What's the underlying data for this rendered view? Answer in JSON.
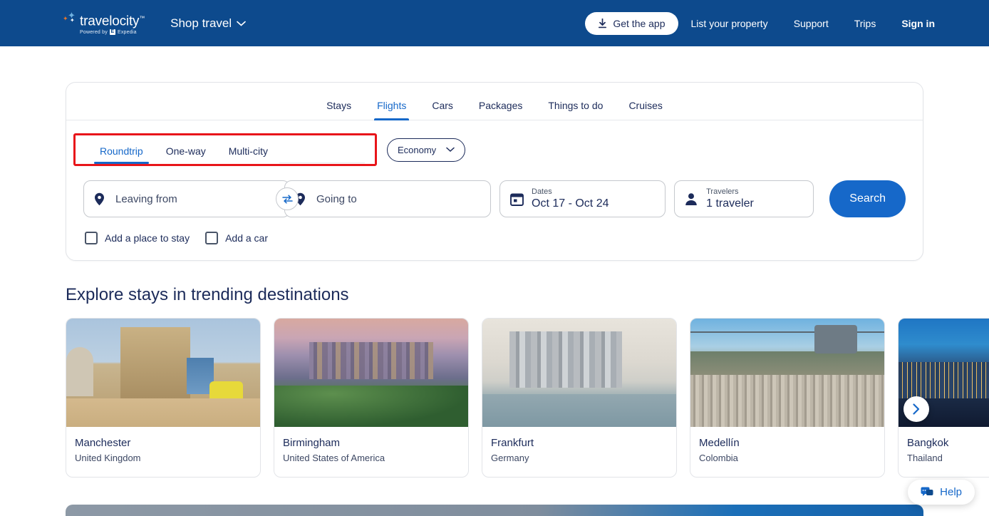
{
  "header": {
    "brand": {
      "name": "travelocity",
      "trademark": "™",
      "powered_by": "Powered by",
      "partner": "Expedia",
      "partner_mark": "E"
    },
    "shop_travel": "Shop travel",
    "get_app": "Get the app",
    "links": [
      {
        "label": "List your property"
      },
      {
        "label": "Support"
      },
      {
        "label": "Trips"
      },
      {
        "label": "Sign in",
        "bold": true
      }
    ],
    "background_color": "#0d4a8d"
  },
  "search_panel": {
    "product_tabs": [
      {
        "label": "Stays",
        "active": false
      },
      {
        "label": "Flights",
        "active": true
      },
      {
        "label": "Cars",
        "active": false
      },
      {
        "label": "Packages",
        "active": false
      },
      {
        "label": "Things to do",
        "active": false
      },
      {
        "label": "Cruises",
        "active": false
      }
    ],
    "trip_types": [
      {
        "label": "Roundtrip",
        "active": true
      },
      {
        "label": "One-way",
        "active": false
      },
      {
        "label": "Multi-city",
        "active": false
      }
    ],
    "highlight_color": "#e8151a",
    "cabin_class": "Economy",
    "fields": {
      "leaving_from": {
        "placeholder": "Leaving from"
      },
      "going_to": {
        "placeholder": "Going to"
      },
      "dates": {
        "label": "Dates",
        "value": "Oct 17 - Oct 24"
      },
      "travelers": {
        "label": "Travelers",
        "value": "1 traveler"
      }
    },
    "search_button": "Search",
    "search_button_color": "#1668c9",
    "checkboxes": [
      {
        "label": "Add a place to stay",
        "checked": false
      },
      {
        "label": "Add a car",
        "checked": false
      }
    ]
  },
  "trending": {
    "title": "Explore stays in trending destinations",
    "cards": [
      {
        "city": "Manchester",
        "country": "United Kingdom",
        "photo": "ph-manchester"
      },
      {
        "city": "Birmingham",
        "country": "United States of America",
        "photo": "ph-birmingham"
      },
      {
        "city": "Frankfurt",
        "country": "Germany",
        "photo": "ph-frankfurt"
      },
      {
        "city": "Medellín",
        "country": "Colombia",
        "photo": "ph-medellin"
      },
      {
        "city": "Bangkok",
        "country": "Thailand",
        "photo": "ph-bangkok"
      }
    ]
  },
  "help": {
    "label": "Help"
  }
}
